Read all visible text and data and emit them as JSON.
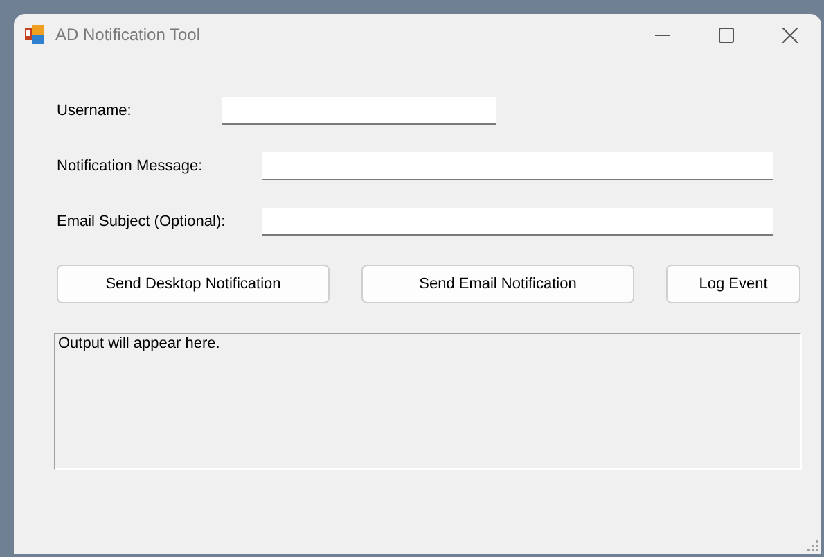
{
  "window": {
    "title": "AD Notification Tool"
  },
  "fields": [
    {
      "label": "Username:"
    },
    {
      "label": "Notification Message:"
    },
    {
      "label": "Email Subject (Optional):"
    }
  ],
  "buttons": [
    "Send Desktop Notification",
    "Send Email Notification",
    "Log Event"
  ],
  "output": {
    "value": "Output will appear here."
  }
}
